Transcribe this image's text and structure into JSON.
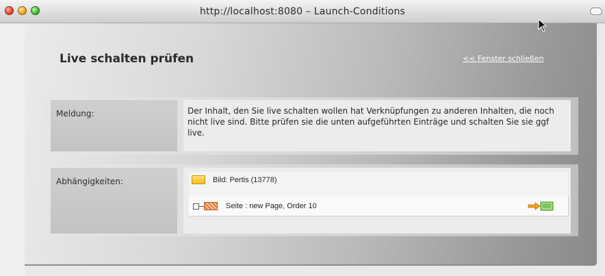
{
  "window": {
    "title": "http://localhost:8080 – Launch-Conditions"
  },
  "page": {
    "heading": "Live schalten prüfen",
    "close_link": "<< Fenster schließen"
  },
  "message_row": {
    "label": "Meldung:",
    "text": "Der Inhalt, den Sie live schalten wollen hat Verknüpfungen zu anderen Inhalten, die noch nicht live sind. Bitte prüfen sie die unten aufgeführten Einträge und schalten Sie sie ggf live."
  },
  "dependencies_row": {
    "label": "Abhängigkeiten:",
    "items": [
      {
        "label": "Bild: Pertis (13778)",
        "icon": "image-icon"
      },
      {
        "label": "Seite : new Page, Order 10",
        "icon": "page-icon",
        "action_icon": "link-arrow-icon"
      }
    ]
  },
  "colors": {
    "folder_icon": "#f2bb20",
    "page_icon": "#e27f3e",
    "link_color": "#ffffff"
  }
}
